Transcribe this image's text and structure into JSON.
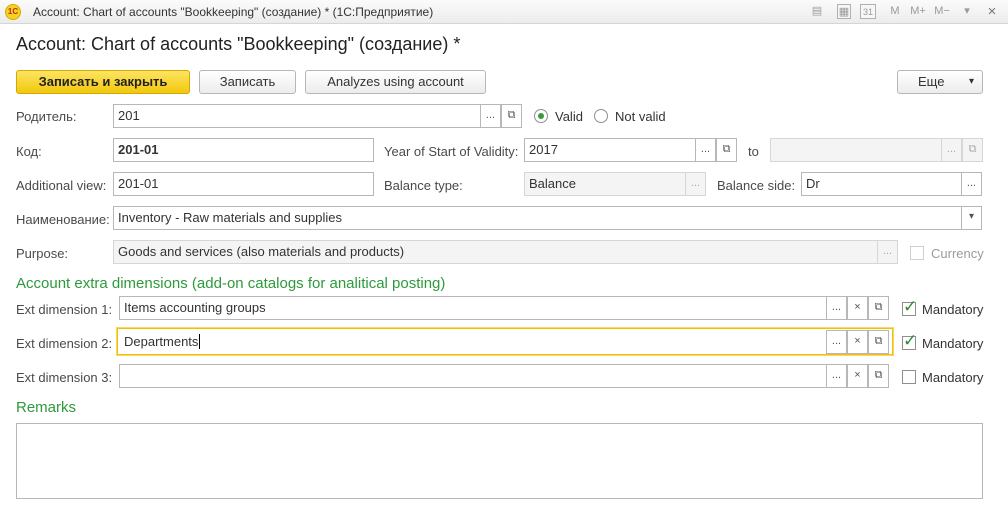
{
  "window": {
    "title": "Account: Chart of accounts \"Bookkeeping\" (создание) *  (1С:Предприятие)",
    "logo": "1С",
    "toolbar_m": "M",
    "toolbar_mplus": "M+",
    "toolbar_mminus": "M−",
    "calendar_day": "31"
  },
  "form": {
    "title": "Account: Chart of accounts \"Bookkeeping\" (создание) *"
  },
  "toolbar": {
    "save_close": "Записать и закрыть",
    "save": "Записать",
    "analyzes": "Analyzes using account",
    "more": "Еще"
  },
  "fields": {
    "parent_label": "Родитель:",
    "parent_value": "201",
    "valid_label": "Valid",
    "not_valid_label": "Not valid",
    "code_label": "Код:",
    "code_value": "201-01",
    "year_label": "Year of Start of Validity:",
    "year_value": "2017",
    "to_label": "to",
    "to_value": "",
    "addview_label": "Additional view:",
    "addview_value": "201-01",
    "balance_type_label": "Balance type:",
    "balance_type_value": "Balance",
    "balance_side_label": "Balance side:",
    "balance_side_value": "Dr",
    "name_label": "Наименование:",
    "name_value": "Inventory - Raw materials and supplies",
    "purpose_label": "Purpose:",
    "purpose_value": "Goods and services (also materials and products)",
    "currency_label": "Currency"
  },
  "dimensions": {
    "section_title": "Account extra dimensions (add-on catalogs for analitical posting)",
    "mandatory_label": "Mandatory",
    "items": [
      {
        "label": "Ext dimension 1:",
        "value": "Items accounting groups",
        "mandatory": true
      },
      {
        "label": "Ext dimension 2:",
        "value": "Departments",
        "mandatory": true
      },
      {
        "label": "Ext dimension 3:",
        "value": "",
        "mandatory": false
      }
    ]
  },
  "remarks": {
    "title": "Remarks",
    "value": ""
  },
  "glyphs": {
    "ellipsis": "...",
    "clear": "×",
    "open": "⧉",
    "dropdown": "▾",
    "close": "×"
  }
}
